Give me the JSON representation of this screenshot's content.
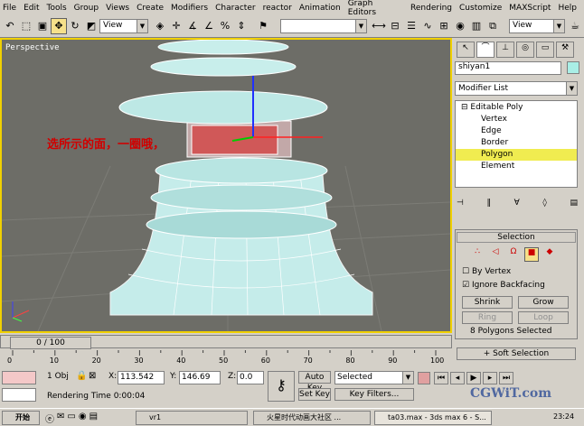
{
  "menu": [
    "File",
    "Edit",
    "Tools",
    "Group",
    "Views",
    "Create",
    "Modifiers",
    "Character",
    "reactor",
    "Animation",
    "Graph Editors",
    "Rendering",
    "Customize",
    "MAXScript",
    "Help"
  ],
  "toolbar": {
    "ref_coord": "View",
    "ref_coord_right": "View"
  },
  "viewport": {
    "label": "Perspective",
    "note": "选所示的面，一圈哦，",
    "sel_bg": "#f0d000"
  },
  "panel": {
    "object_name": "shiyan1",
    "object_color": "#a9eee6",
    "modifier_list": "Modifier List",
    "stack": [
      "Editable Poly",
      "Vertex",
      "Edge",
      "Border",
      "Polygon",
      "Element"
    ],
    "selection": {
      "title": "Selection",
      "by_vertex": "By Vertex",
      "ignore_backfacing": "Ignore Backfacing",
      "shrink": "Shrink",
      "grow": "Grow",
      "ring": "Ring",
      "loop": "Loop",
      "status": "8 Polygons Selected"
    },
    "soft_selection": "Soft Selection"
  },
  "timeline": {
    "frame": "0 / 100",
    "ticks": [
      "0",
      "10",
      "20",
      "30",
      "40",
      "50",
      "60",
      "70",
      "80",
      "90",
      "100"
    ]
  },
  "status": {
    "objects": "1 Obj",
    "x": "113.542",
    "y": "146.69",
    "z": "0.0",
    "auto_key": "Auto Key",
    "set_key": "Set Key",
    "selected": "Selected",
    "key_filters": "Key Filters...",
    "render_time": "Rendering Time  0:00:04",
    "x_lbl": "X:",
    "y_lbl": "Y:",
    "z_lbl": "Z:"
  },
  "taskbar": {
    "start": "开始",
    "items": [
      "vr1",
      "火星时代动画大社区 ...",
      "ta03.max - 3ds max 6 - S..."
    ],
    "clock": "23:24",
    "watermark": "CGWiT.com"
  }
}
